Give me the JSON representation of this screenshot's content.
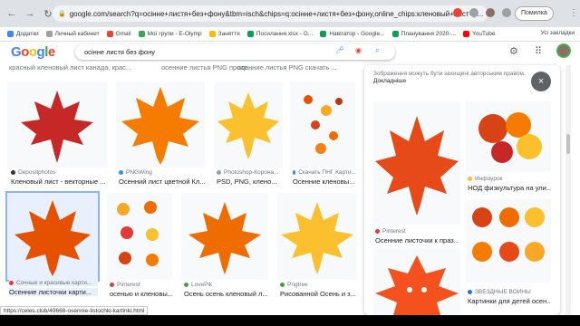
{
  "browser": {
    "url": "google.com/search?q=осінне+листя+без+фону&tbm=isch&chips=q:осінне+листя+без+фону,online_chips:кленовый+лист+р...",
    "pause_label": "Помилка",
    "bookmarks": [
      "Додатки",
      "Личный кабинет",
      "Gmail",
      "Мої групи - E-Olymp",
      "Заняття",
      "Посилання.xlsx - G...",
      "Навігатор - Google...",
      "Планування 2020-...",
      "YouTube"
    ],
    "bookmarks_right": "Усі закладки"
  },
  "google": {
    "logo": [
      "G",
      "o",
      "o",
      "g",
      "l",
      "e"
    ],
    "query": "осінне листя без фону"
  },
  "top_captions": [
    "красный кленовый лист канада, крас...",
    "осенние листья PNG прозр...",
    "осенние листья PNG скачать ..."
  ],
  "results": [
    {
      "source": "Depositphotos",
      "title": "Кленовый лист - векторные ..."
    },
    {
      "source": "PNGWing",
      "title": "Осенний лист цветной Кл..."
    },
    {
      "source": "Photoshop-Корона...",
      "title": "PSD, PNG, клено..."
    },
    {
      "source": "Скачать ПНГ Карти...",
      "title": "Осенние кленовы..."
    },
    {
      "source": "Сочные и красивые карти...",
      "title": "Осенние листочки карти..."
    },
    {
      "source": "Pinterest",
      "title": "осенью и кленовы..."
    },
    {
      "source": "LovePik",
      "title": "Осень осень кленовый л..."
    },
    {
      "source": "Pngtree",
      "title": "Рисованной Осень и з..."
    }
  ],
  "panel": {
    "notice": "Зображення можуть бути захищені авторським правом.",
    "notice_link": "Докладніше",
    "close": "×",
    "items": [
      {
        "source": "Pinterest",
        "title": "Осенние листочки к праз..."
      },
      {
        "source": "Инфоурок",
        "title": "НОД физкультура на ули..."
      },
      {
        "source": "ЗВЁЗДНЫЕ ВОЙНЫ",
        "title": "Картинки для детей осен..."
      }
    ]
  },
  "status_url": "https://celes.club/49668-osennie-listochki-kartinki.html",
  "colors": {
    "accent": "#1a73e8",
    "leaf_red": "#d32f2f",
    "leaf_orange": "#f57c00",
    "leaf_yellow": "#fbc02d"
  }
}
